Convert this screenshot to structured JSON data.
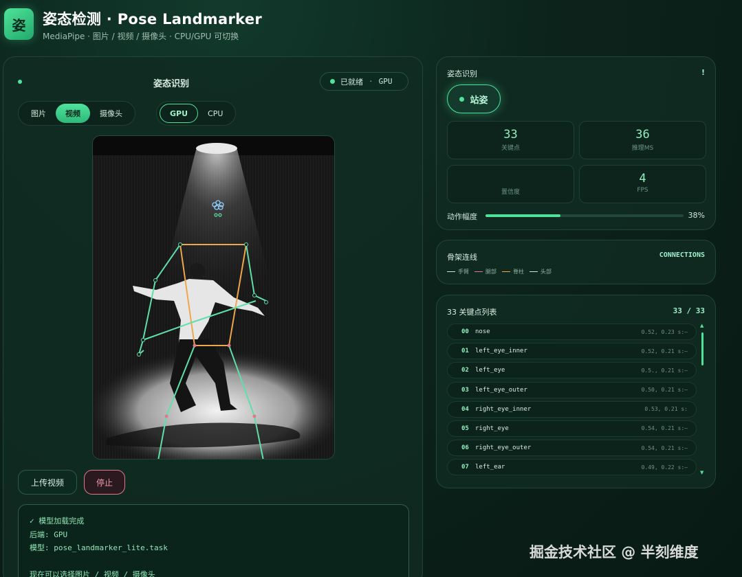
{
  "app": {
    "icon_char": "姿",
    "title": "姿态检测 · Pose Landmarker",
    "subtitle": "MediaPipe · 图片 / 视频 / 摄像头 · CPU/GPU 可切换"
  },
  "left_panel": {
    "title": "姿态识别",
    "status": {
      "label": "已就绪",
      "separator": "·",
      "backend": "GPU"
    },
    "source_tabs": [
      {
        "label": "图片",
        "active": false
      },
      {
        "label": "视频",
        "active": true
      },
      {
        "label": "摄像头",
        "active": false
      }
    ],
    "backend_tabs": [
      {
        "label": "GPU",
        "active": true
      },
      {
        "label": "CPU",
        "active": false
      }
    ],
    "upload_label": "上传视频",
    "stop_label": "停止",
    "log": {
      "line1": "✓ 模型加载完成",
      "line2_key": "后端:",
      "line2_val": "GPU",
      "line3_key": "模型:",
      "line3_val": "pose_landmarker_lite.task",
      "line4": "现在可以选择图片 / 视频 / 摄像头"
    }
  },
  "recognition": {
    "title": "姿态识别",
    "right_mark": "!",
    "pose_label": "站姿",
    "stats": [
      {
        "value": "33",
        "label": "关键点"
      },
      {
        "value": "36",
        "label": "推理MS"
      },
      {
        "value": "",
        "label": "置信度"
      },
      {
        "value": "4",
        "label": "FPS"
      }
    ],
    "amplitude_label": "动作幅度",
    "amplitude_percent": 38,
    "amplitude_text": "38%"
  },
  "skeleton": {
    "title": "骨架连线",
    "right_mark": "CONNECTIONS",
    "legend": [
      {
        "label": "手臂",
        "color": "#c9e6d8"
      },
      {
        "label": "腿部",
        "color": "#e0788c"
      },
      {
        "label": "脊柱",
        "color": "#f0a64a"
      },
      {
        "label": "头部",
        "color": "#c9e6d8"
      }
    ]
  },
  "keypoints": {
    "title": "33 关键点列表",
    "count": "33 / 33",
    "rows": [
      {
        "idx": "00",
        "name": "nose",
        "coord": "0.52, 0.23 s:—"
      },
      {
        "idx": "01",
        "name": "left_eye_inner",
        "coord": "0.52, 0.21 s:—"
      },
      {
        "idx": "02",
        "name": "left_eye",
        "coord": "0.5., 0.21 s:—"
      },
      {
        "idx": "03",
        "name": "left_eye_outer",
        "coord": "0.50, 0.21 s:—"
      },
      {
        "idx": "04",
        "name": "right_eye_inner",
        "coord": "0.53, 0.21 s:"
      },
      {
        "idx": "05",
        "name": "right_eye",
        "coord": "0.54, 0.21 s:—"
      },
      {
        "idx": "06",
        "name": "right_eye_outer",
        "coord": "0.54, 0.21 s:—"
      },
      {
        "idx": "07",
        "name": "left_ear",
        "coord": "0.49, 0.22 s:—"
      }
    ]
  },
  "colors": {
    "accent": "#4fe39a",
    "arm_line": "#5fe0a8",
    "torso_line": "#f0a64a",
    "leg_point": "#e0788c",
    "head_point": "#8fd0ff"
  },
  "watermark": "掘金技术社区 @ 半刻维度"
}
